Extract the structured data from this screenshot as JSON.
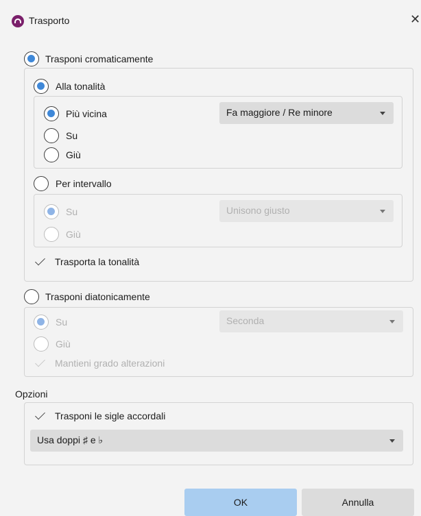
{
  "window": {
    "title": "Trasporto",
    "close_symbol": "✕"
  },
  "chromatic": {
    "label": "Trasponi cromaticamente",
    "to_key": {
      "label": "Alla tonalità",
      "options": [
        "Più vicina",
        "Su",
        "Giù"
      ],
      "selected": "Più vicina",
      "key_select": "Fa maggiore / Re minore"
    },
    "by_interval": {
      "label": "Per intervallo",
      "options": [
        "Su",
        "Giù"
      ],
      "selected": "Su",
      "interval_select": "Unisono giusto"
    },
    "transpose_key_label": "Trasporta la tonalità"
  },
  "diatonic": {
    "label": "Trasponi diatonicamente",
    "options": [
      "Su",
      "Giù"
    ],
    "selected": "Su",
    "degree_select": "Seconda",
    "keep_degree_label": "Mantieni grado alterazioni"
  },
  "options": {
    "header": "Opzioni",
    "chord_symbols_label": "Trasponi le sigle accordali",
    "accidentals_select": "Usa doppi ♯ e ♭"
  },
  "buttons": {
    "ok": "OK",
    "cancel": "Annulla"
  }
}
